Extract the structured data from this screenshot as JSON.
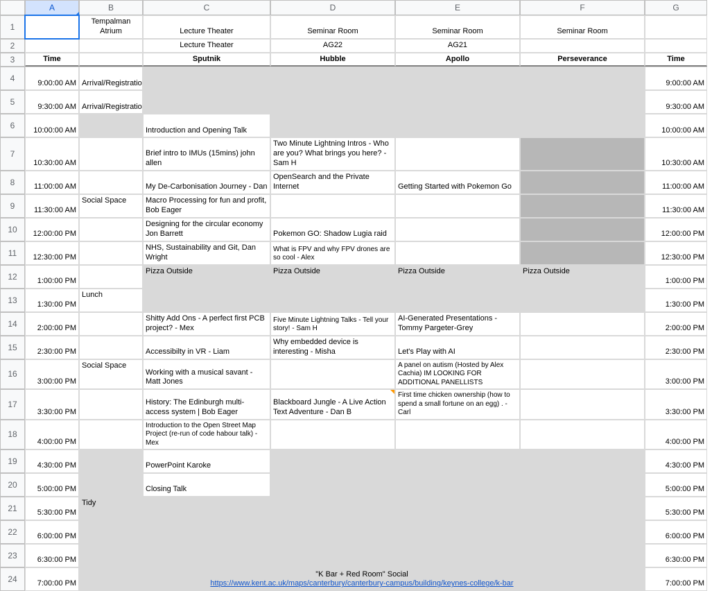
{
  "cols": [
    "A",
    "B",
    "C",
    "D",
    "E",
    "F",
    "G"
  ],
  "row1": {
    "b": "Tempalman Atrium",
    "c": "Lecture Theater",
    "d": "Seminar Room",
    "e": "Seminar Room",
    "f": "Seminar Room"
  },
  "row2": {
    "c": "Lecture Theater",
    "d": "AG22",
    "e": "AG21"
  },
  "row3": {
    "a": "Time",
    "c": "Sputnik",
    "d": "Hubble",
    "e": "Apollo",
    "f": "Perseverance",
    "g": "Time"
  },
  "rows": [
    {
      "n": 4,
      "a": "9:00:00 AM",
      "b": "Arrival/Registration",
      "g": "9:00:00 AM",
      "greyC": true,
      "greyD": true,
      "greyE": true,
      "greyF": true
    },
    {
      "n": 5,
      "a": "9:30:00 AM",
      "b": "Arrival/Registration",
      "g": "9:30:00 AM",
      "greyC": true,
      "greyD": true,
      "greyE": true,
      "greyF": true
    },
    {
      "n": 6,
      "a": "10:00:00 AM",
      "c": "Introduction and Opening Talk",
      "g": "10:00:00 AM",
      "greyB": true,
      "greyD": true,
      "greyE": true,
      "greyF": true
    },
    {
      "n": 7,
      "a": "10:30:00 AM",
      "c": "Brief intro to IMUs (15mins) john allen",
      "d": "Two Minute Lightning Intros - Who are you? What brings you here? - Sam H",
      "g": "10:30:00 AM",
      "darkF": true
    },
    {
      "n": 8,
      "a": "11:00:00 AM",
      "c": "My De-Carbonisation Journey - Dan",
      "d": "OpenSearch and the Private Internet",
      "e": "Getting Started with Pokemon Go",
      "g": "11:00:00 AM",
      "darkF": true
    },
    {
      "n": 9,
      "a": "11:30:00 AM",
      "b": "Social Space",
      "c": "Macro Processing for fun and profit, Bob Eager",
      "g": "11:30:00 AM",
      "darkF": true,
      "topB": true
    },
    {
      "n": 10,
      "a": "12:00:00 PM",
      "c": "Designing for the circular economy Jon Barrett",
      "d": "Pokemon GO: Shadow Lugia raid",
      "g": "12:00:00 PM",
      "darkF": true
    },
    {
      "n": 11,
      "a": "12:30:00 PM",
      "c": "NHS, Sustainability and Git, Dan Wright",
      "d": "What is FPV and why FPV drones are so cool  - Alex",
      "g": "12:30:00 PM",
      "darkF": true,
      "smallD": true
    },
    {
      "n": 12,
      "a": "1:00:00 PM",
      "c": "Pizza Outside",
      "d": "Pizza Outside",
      "e": "Pizza Outside",
      "f": "Pizza Outside",
      "g": "1:00:00 PM",
      "greyC": true,
      "greyD": true,
      "greyE": true,
      "greyF": true,
      "topRow": true
    },
    {
      "n": 13,
      "a": "1:30:00 PM",
      "b": "Lunch",
      "g": "1:30:00 PM",
      "greyC": true,
      "greyD": true,
      "greyE": true,
      "greyF": true,
      "topB": true
    },
    {
      "n": 14,
      "a": "2:00:00 PM",
      "c": "Shitty Add Ons - A perfect first PCB project? - Mex",
      "d": "Five Minute Lightning Talks - Tell your story! - Sam H",
      "e": "AI-Generated Presentations - Tommy Pargeter-Grey",
      "g": "2:00:00 PM",
      "smallD": true
    },
    {
      "n": 15,
      "a": "2:30:00 PM",
      "c": "Accessibilty in VR - Liam",
      "d": "Why embedded device is interesting - Misha",
      "e": "Let's Play with AI",
      "g": "2:30:00 PM"
    },
    {
      "n": 16,
      "a": "3:00:00 PM",
      "b": "Social Space",
      "c": "Working with a musical savant - Matt Jones",
      "e": "A panel on autism (Hosted by Alex Cachia) IM LOOKING FOR ADDITIONAL PANELLISTS",
      "g": "3:00:00 PM",
      "smallE": true,
      "topB": true
    },
    {
      "n": 17,
      "a": "3:30:00 PM",
      "c": "History: The Edinburgh multi-access system | Bob Eager",
      "d": "Blackboard Jungle - A Live Action Text Adventure - Dan B",
      "e": "First time chicken ownership (how to spend a small fortune on an egg) . - Carl",
      "g": "3:30:00 PM",
      "smallE": true,
      "markD": true
    },
    {
      "n": 18,
      "a": "4:00:00 PM",
      "c": "Introduction to the Open Street Map Project (re-run of code habour talk) - Mex",
      "g": "4:00:00 PM",
      "smallC": true
    },
    {
      "n": 19,
      "a": "4:30:00 PM",
      "c": "PowerPoint Karoke",
      "g": "4:30:00 PM",
      "greyB": true,
      "greyD": true,
      "greyE": true,
      "greyF": true
    },
    {
      "n": 20,
      "a": "5:00:00 PM",
      "c": "Closing Talk",
      "g": "5:00:00 PM",
      "greyB": true,
      "greyD": true,
      "greyE": true,
      "greyF": true
    },
    {
      "n": 21,
      "a": "5:30:00 PM",
      "b": "Tidy",
      "g": "5:30:00 PM",
      "greyB": true,
      "greyC": true,
      "greyD": true,
      "greyE": true,
      "greyF": true,
      "topB": true
    }
  ],
  "social": {
    "title": "\"K Bar + Red Room\" Social",
    "link": "https://www.kent.ac.uk/maps/canterbury/canterbury-campus/building/keynes-college/k-bar"
  },
  "tailTimes": [
    {
      "n": 22,
      "a": "6:00:00 PM",
      "g": "6:00:00 PM"
    },
    {
      "n": 23,
      "a": "6:30:00 PM",
      "g": "6:30:00 PM"
    },
    {
      "n": 24,
      "a": "7:00:00 PM",
      "g": "7:00:00 PM"
    }
  ]
}
